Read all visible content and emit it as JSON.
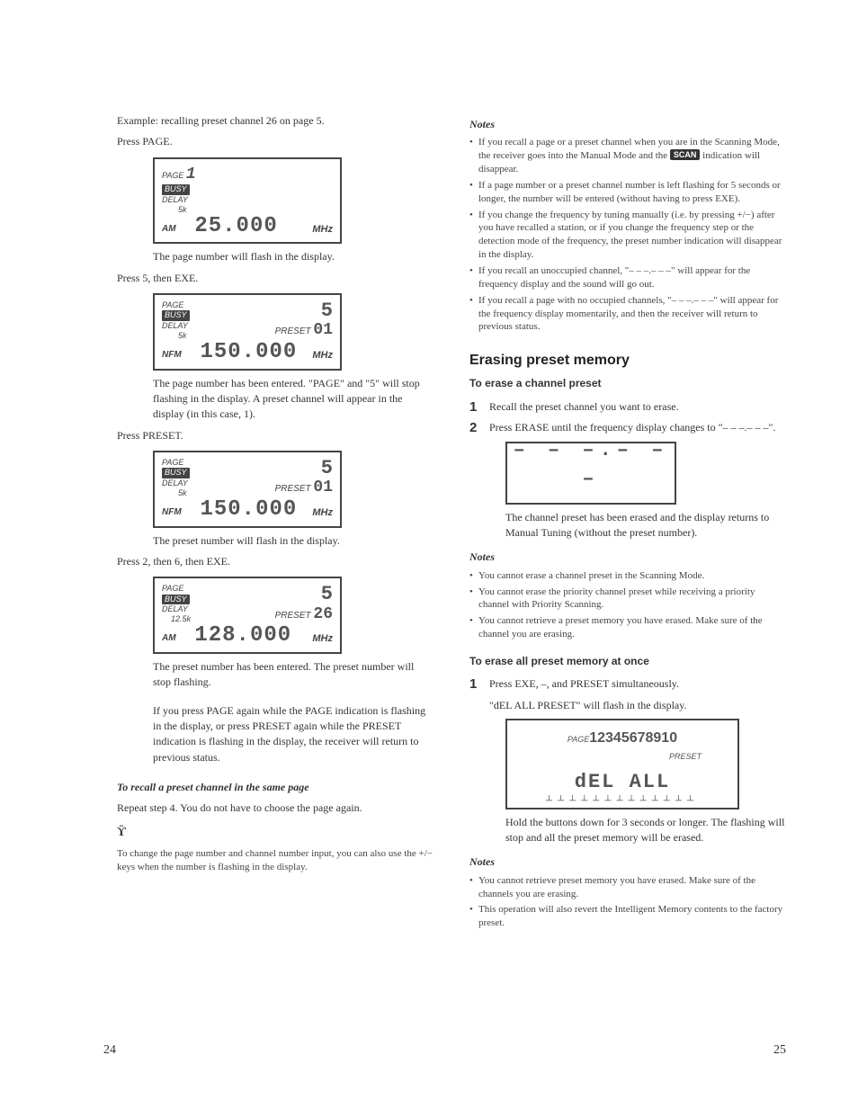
{
  "left": {
    "example_line1": "Example: recalling preset channel 26 on page 5.",
    "example_line2": "Press PAGE.",
    "lcd1": {
      "page_label": "PAGE",
      "page_num": "1",
      "busy": "BUSY",
      "delay": "DELAY",
      "step": "5k",
      "mode": "AM",
      "freq": "25.000",
      "unit": "MHz"
    },
    "caption1": "The page number will flash in the display.",
    "step2": "Press 5, then EXE.",
    "lcd2": {
      "page_label": "PAGE",
      "page_num": "5",
      "busy": "BUSY",
      "delay": "DELAY",
      "step": "5k",
      "mode": "NFM",
      "preset_label": "PRESET",
      "preset_num": "01",
      "freq": "150.000",
      "unit": "MHz"
    },
    "caption2": "The page number has been entered. \"PAGE\" and \"5\" will stop flashing in the display. A preset channel will appear in the display (in this case, 1).",
    "step3": "Press PRESET.",
    "lcd3": {
      "page_label": "PAGE",
      "page_num": "5",
      "busy": "BUSY",
      "delay": "DELAY",
      "step": "5k",
      "mode": "NFM",
      "preset_label": "PRESET",
      "preset_num": "01",
      "freq": "150.000",
      "unit": "MHz"
    },
    "caption3": "The preset number will flash in the display.",
    "step4": "Press 2, then 6, then EXE.",
    "lcd4": {
      "page_label": "PAGE",
      "page_num": "5",
      "busy": "BUSY",
      "delay": "DELAY",
      "step": "12.5k",
      "mode": "AM",
      "preset_label": "PRESET",
      "preset_num": "26",
      "freq": "128.000",
      "unit": "MHz"
    },
    "caption4": "The preset number has been entered. The preset number will stop flashing.",
    "caption5": "If you press PAGE again while the PAGE indication is flashing in the display, or press PRESET again while the PRESET indication is flashing in the display, the receiver will return to previous status.",
    "sub1_title": "To recall a preset channel in the same page",
    "sub1_body": "Repeat step 4. You do not have to choose the page again.",
    "tip_body": "To change the page number and channel number input, you can also use the +/− keys when the number is flashing in the display.",
    "page_num": "24"
  },
  "right": {
    "notes_title": "Notes",
    "notes1": [
      {
        "text_a": "If you recall a page or a preset channel when you are in the Scanning Mode, the receiver goes into the Manual Mode and the ",
        "badge": "SCAN",
        "text_b": " indication will disappear."
      },
      {
        "text": "If a page number or a preset channel number is left flashing for 5 seconds or longer, the number will be entered (without having to press EXE)."
      },
      {
        "text": "If you change the frequency by tuning manually (i.e. by pressing +/−) after you have recalled a station, or if you change the frequency step or the detection mode of the frequency, the preset number indication will disappear in the display."
      },
      {
        "text": "If you recall an unoccupied channel, \"– – –.– – –\" will appear for the frequency display and the sound will go out."
      },
      {
        "text": "If you recall a page with no occupied channels, \"– – –.– – –\" will appear for the frequency display momentarily, and then the receiver will return to previous status."
      }
    ],
    "section_title": "Erasing preset memory",
    "sub_a_title": "To erase a channel preset",
    "steps_a": [
      "Recall the preset channel you want to erase.",
      "Press ERASE until the frequency display changes to \"– – –.– – –\"."
    ],
    "lcd_erase_dashes": "– – –.– – –",
    "caption_a": "The channel preset has been erased and the display returns to Manual Tuning (without the preset number).",
    "notes2_title": "Notes",
    "notes2": [
      "You cannot erase a channel preset in the Scanning Mode.",
      "You cannot erase the priority channel preset while receiving a priority channel with Priority Scanning.",
      "You cannot retrieve a preset memory you have erased. Make sure of the channel you are erasing."
    ],
    "sub_b_title": "To erase all preset memory at once",
    "steps_b1": "Press EXE, –, and PRESET simultaneously.",
    "steps_b1b": "\"dEL ALL PRESET\" will flash in the display.",
    "lcd_del": {
      "page_label": "PAGE",
      "pages": "12345678910",
      "preset_label": "PRESET",
      "del_text": "dEL ALL"
    },
    "caption_b": "Hold the buttons down for 3 seconds or longer. The flashing will stop and all the preset memory will be erased.",
    "notes3_title": "Notes",
    "notes3": [
      "You cannot retrieve preset memory you have erased. Make sure of the channels you are erasing.",
      "This operation will also revert the Intelligent Memory contents to the factory preset."
    ],
    "page_num": "25"
  }
}
